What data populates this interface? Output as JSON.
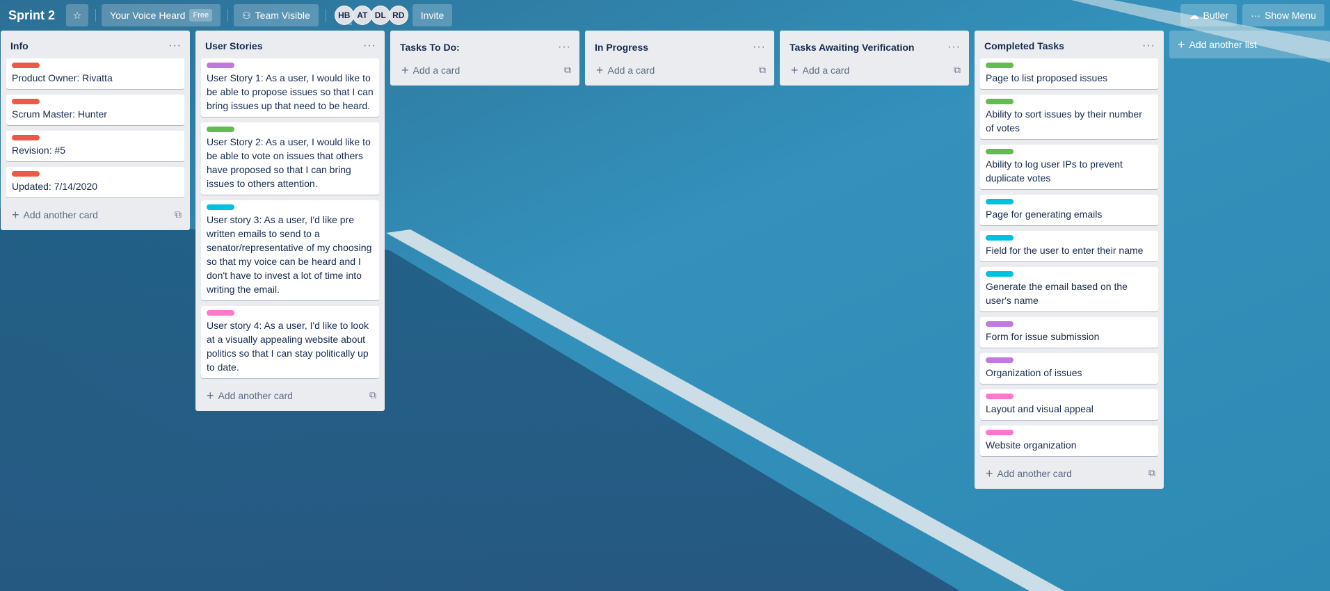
{
  "header": {
    "board_title": "Sprint 2",
    "team_name": "Your Voice Heard",
    "team_badge": "Free",
    "visibility": "Team Visible",
    "members": [
      {
        "initials": "HB"
      },
      {
        "initials": "AT"
      },
      {
        "initials": "DL"
      },
      {
        "initials": "RD"
      }
    ],
    "invite_label": "Invite",
    "butler_label": "Butler",
    "show_menu_label": "Show Menu"
  },
  "label_colors": {
    "red": "#eb5a46",
    "green": "#61bd4f",
    "purple": "#c377e0",
    "sky": "#00c2e0",
    "pink": "#ff78cb"
  },
  "lists": [
    {
      "title": "Info",
      "cards": [
        {
          "label": "red",
          "title": "Product Owner: Rivatta"
        },
        {
          "label": "red",
          "title": "Scrum Master: Hunter"
        },
        {
          "label": "red",
          "title": "Revision: #5"
        },
        {
          "label": "red",
          "title": "Updated: 7/14/2020"
        }
      ],
      "footer": "Add another card"
    },
    {
      "title": "User Stories",
      "cards": [
        {
          "label": "purple",
          "title": "User Story 1: As a user, I would like to be able to propose issues so that I can bring issues up that need to be heard."
        },
        {
          "label": "green",
          "title": "User Story 2: As a user, I would like to be able to vote on issues that others have proposed so that I can bring issues to others attention."
        },
        {
          "label": "sky",
          "title": "User story 3: As a user, I'd like pre written emails to send to a senator/representative of my choosing so that my voice can be heard and I don't have to invest a lot of time into writing the email."
        },
        {
          "label": "pink",
          "title": "User story 4: As a user, I'd like to look at a visually appealing website about politics so that I can stay politically up to date."
        }
      ],
      "footer": "Add another card"
    },
    {
      "title": "Tasks To Do:",
      "cards": [],
      "footer": "Add a card"
    },
    {
      "title": "In Progress",
      "cards": [],
      "footer": "Add a card"
    },
    {
      "title": "Tasks Awaiting Verification",
      "cards": [],
      "footer": "Add a card"
    },
    {
      "title": "Completed Tasks",
      "cards": [
        {
          "label": "green",
          "title": "Page to list proposed issues"
        },
        {
          "label": "green",
          "title": "Ability to sort issues by their number of votes"
        },
        {
          "label": "green",
          "title": "Ability to log user IPs to prevent duplicate votes"
        },
        {
          "label": "sky",
          "title": "Page for generating emails"
        },
        {
          "label": "sky",
          "title": "Field for the user to enter their name"
        },
        {
          "label": "sky",
          "title": "Generate the email based on the user's name"
        },
        {
          "label": "purple",
          "title": "Form for issue submission"
        },
        {
          "label": "purple",
          "title": "Organization of issues"
        },
        {
          "label": "pink",
          "title": "Layout and visual appeal"
        },
        {
          "label": "pink",
          "title": "Website organization"
        }
      ],
      "footer": "Add another card"
    }
  ],
  "add_list_label": "Add another list",
  "icons": {
    "star": "star-icon",
    "team": "team-icon",
    "butler": "butler-icon",
    "menu": "more-icon",
    "list_menu": "ellipsis-icon",
    "template": "card-template-icon",
    "add": "plus-icon"
  }
}
